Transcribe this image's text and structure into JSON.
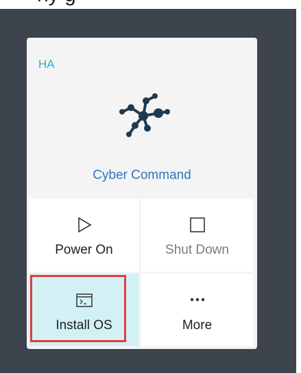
{
  "page_heading_cut": "ny g",
  "card": {
    "label": "HA",
    "icon": "network-nodes-icon",
    "title": "Cyber Command"
  },
  "actions": [
    {
      "label": "Power On",
      "icon": "play-icon",
      "state": "enabled"
    },
    {
      "label": "Shut Down",
      "icon": "stop-icon",
      "state": "disabled"
    },
    {
      "label": "Install OS",
      "icon": "terminal-icon",
      "state": "selected"
    },
    {
      "label": "More",
      "icon": "ellipsis-icon",
      "state": "enabled"
    }
  ],
  "colors": {
    "background": "#3d444d",
    "card": "#f4f4f4",
    "accent_label": "#1fb3d1",
    "title": "#2f74c0",
    "selected": "#d3f1f4",
    "highlight": "#e33b3b",
    "icon": "#1f3a4f"
  }
}
